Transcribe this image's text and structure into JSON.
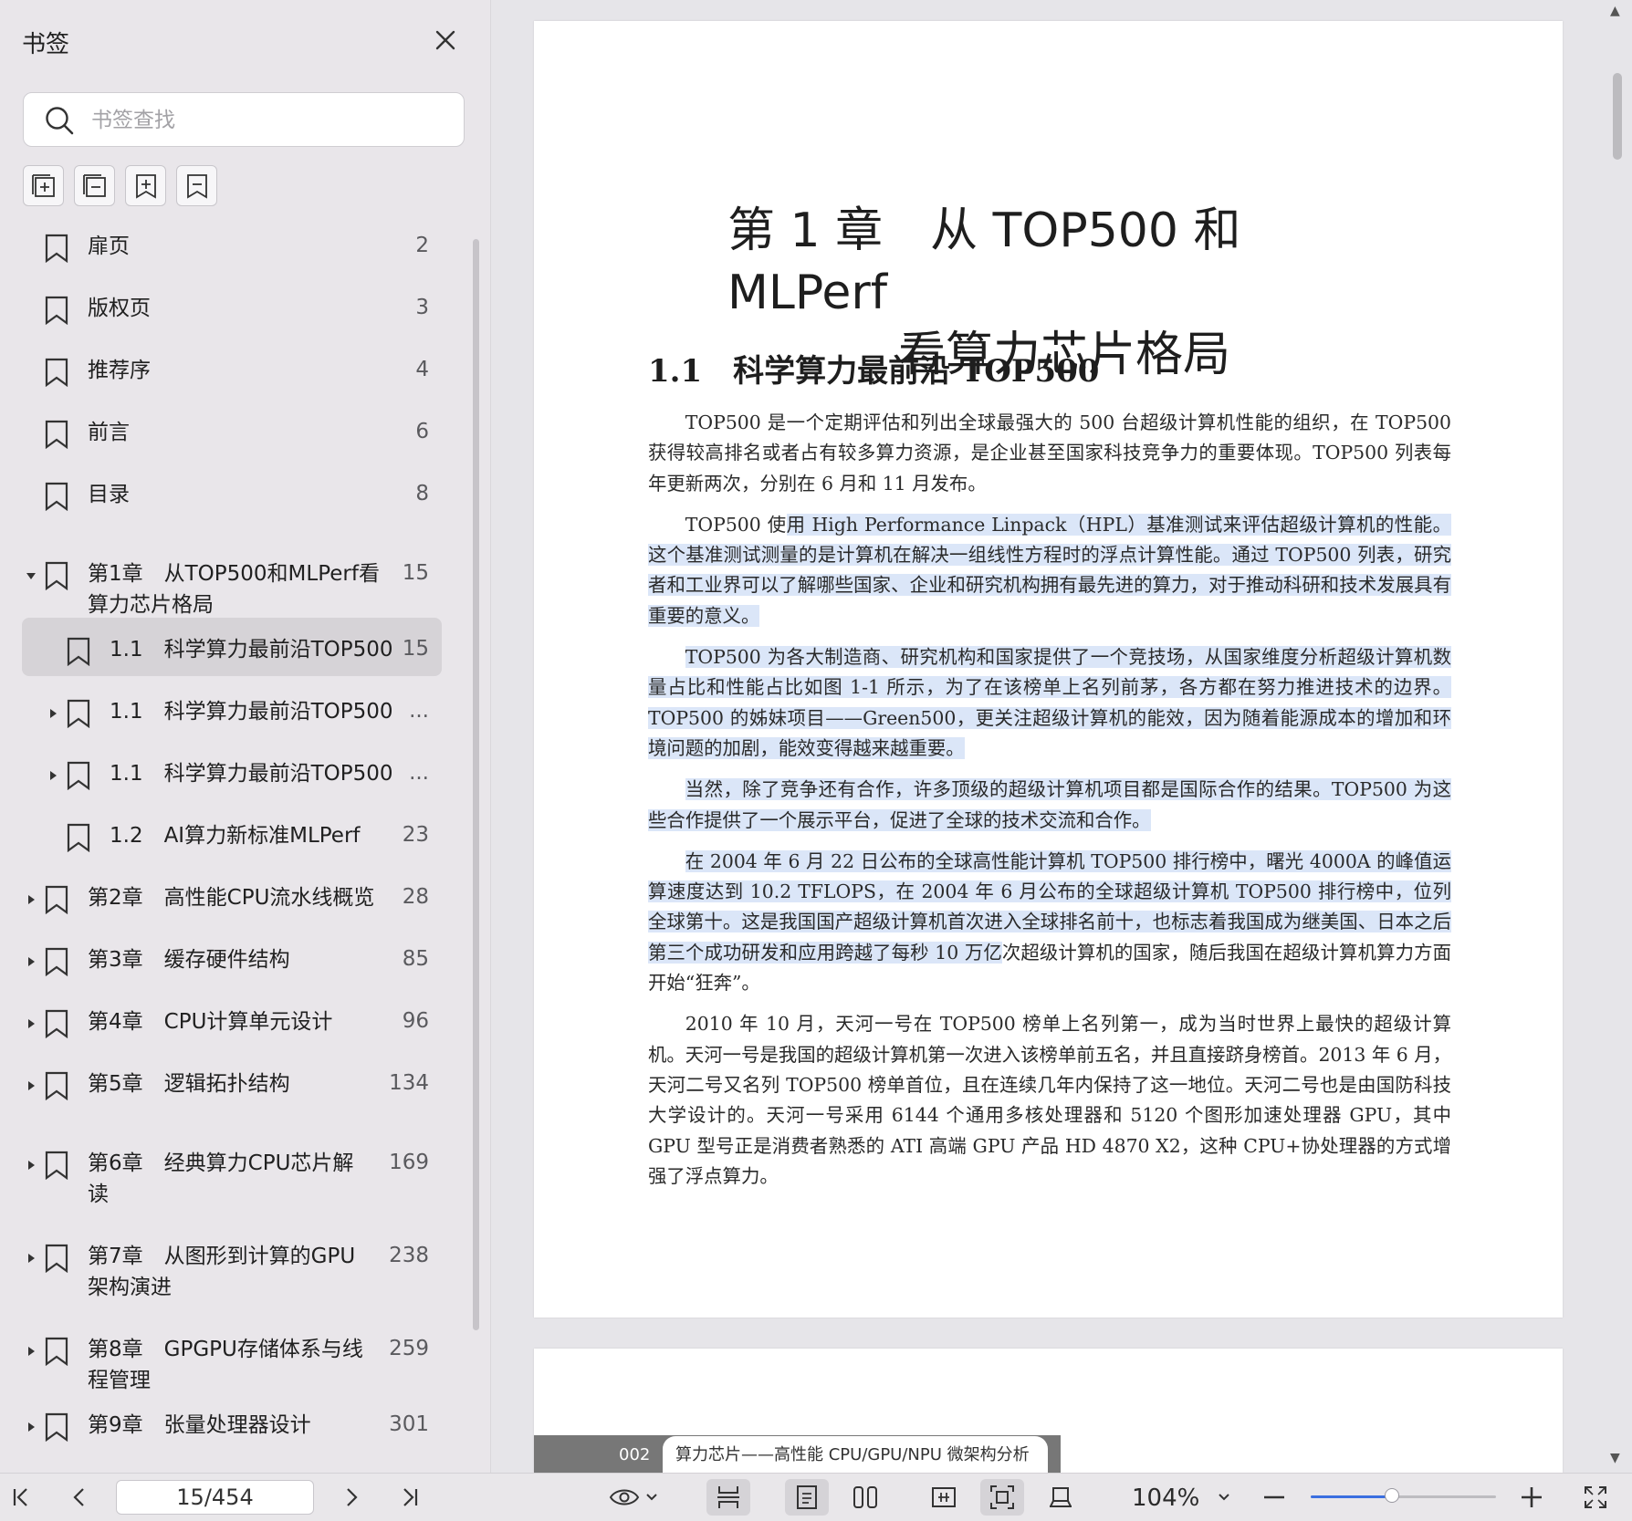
{
  "sidebar": {
    "title": "书签",
    "search_placeholder": "书签查找",
    "tool_icons": [
      "expand-all-icon",
      "collapse-all-icon",
      "add-bookmark-icon",
      "remove-bookmark-icon"
    ],
    "items": [
      {
        "label_lines": [
          "扉页"
        ],
        "page": "2",
        "level": 0,
        "expander": "none"
      },
      {
        "label_lines": [
          "版权页"
        ],
        "page": "3",
        "level": 0,
        "expander": "none"
      },
      {
        "label_lines": [
          "推荐序"
        ],
        "page": "4",
        "level": 0,
        "expander": "none"
      },
      {
        "label_lines": [
          "前言"
        ],
        "page": "6",
        "level": 0,
        "expander": "none"
      },
      {
        "label_lines": [
          "目录"
        ],
        "page": "8",
        "level": 0,
        "expander": "none"
      },
      {
        "label_lines": [
          "第1章　从TOP500和MLPerf看",
          "算力芯片格局"
        ],
        "page": "15",
        "level": 0,
        "expander": "expanded"
      },
      {
        "label_lines": [
          "1.1　科学算力最前沿TOP500"
        ],
        "page": "15",
        "level": 1,
        "expander": "none",
        "active": true
      },
      {
        "label_lines": [
          "1.1　科学算力最前沿TOP500"
        ],
        "page": "...",
        "level": 1,
        "expander": "collapsed"
      },
      {
        "label_lines": [
          "1.1　科学算力最前沿TOP500"
        ],
        "page": "...",
        "level": 1,
        "expander": "collapsed"
      },
      {
        "label_lines": [
          "1.2　AI算力新标准MLPerf"
        ],
        "page": "23",
        "level": 1,
        "expander": "none"
      },
      {
        "label_lines": [
          "第2章　高性能CPU流水线概览"
        ],
        "page": "28",
        "level": 0,
        "expander": "collapsed"
      },
      {
        "label_lines": [
          "第3章　缓存硬件结构"
        ],
        "page": "85",
        "level": 0,
        "expander": "collapsed"
      },
      {
        "label_lines": [
          "第4章　CPU计算单元设计"
        ],
        "page": "96",
        "level": 0,
        "expander": "collapsed"
      },
      {
        "label_lines": [
          "第5章　逻辑拓扑结构"
        ],
        "page": "134",
        "level": 0,
        "expander": "collapsed"
      },
      {
        "label_lines": [
          "第6章　经典算力CPU芯片解",
          "读"
        ],
        "page": "169",
        "level": 0,
        "expander": "collapsed"
      },
      {
        "label_lines": [
          "第7章　从图形到计算的GPU",
          "架构演进"
        ],
        "page": "238",
        "level": 0,
        "expander": "collapsed"
      },
      {
        "label_lines": [
          "第8章　GPGPU存储体系与线",
          "程管理"
        ],
        "page": "259",
        "level": 0,
        "expander": "collapsed"
      },
      {
        "label_lines": [
          "第9章　张量处理器设计"
        ],
        "page": "301",
        "level": 0,
        "expander": "collapsed"
      }
    ]
  },
  "document": {
    "chapter_title_line1": "第 1 章　从 TOP500 和 MLPerf",
    "chapter_title_line2": "看算力芯片格局",
    "section_title": "1.1　科学算力最前沿 TOP500",
    "paragraphs": [
      [
        {
          "t": "TOP500 是一个定期评估和列出全球最强大的 500 台超级计算机性能的组织，在 TOP500 获得较高排名或者占有较多算力资源，是企业甚至国家科技竞争力的重要体现。TOP500 列表每年更新两次，分别在 6 月和 11 月发布。",
          "sel": false
        }
      ],
      [
        {
          "t": "TOP500 使",
          "sel": false
        },
        {
          "t": "用 High Performance Linpack（HPL）基准测试来评估超级计算机的性能。这个基准测试测量的是计算机在解决一组线性方程时的浮点计算性能。通过 TOP500 列表，研究者和工业界可以了解哪些国家、企业和研究机构拥有最先进的算力，对于推动科研和技术发展具有重要的意义。",
          "sel": true
        }
      ],
      [
        {
          "t": "TOP500 为各大制造商、研究机构和国家提供了一个竞技场，从国家维度分析超级计算机数量占比和性能占比如图 1-1 所示，为了在该榜单上名列前茅，各方都在努力推进技术的边界。TOP500 的姊妹项目——Green500，更关注超级计算机的能效，因为随着能源成本的增加和环境问题的加剧，能效变得越来越重要。",
          "sel": true
        }
      ],
      [
        {
          "t": "当然，除了竞争还有合作，许多顶级的超级计算机项目都是国际合作的结果。TOP500 为这些合作提供了一个展示平台，促进了全球的技术交流和合作。",
          "sel": true
        }
      ],
      [
        {
          "t": "在 2004 年 6 月 22 日公布的全球高性能计算机 TOP500 排行榜中，曙光 4000A 的峰值运算速度达到 10.2 TFLOPS，在 2004 年 6 月公布的全球超级计算机 TOP500 排行榜中，位列全球第十。这是我国国产超级计算机首次进入全球排名前十，也标志着我国成为继美国、日本之后第三个成功研发和应用跨越了每秒 10 万亿",
          "sel": true
        },
        {
          "t": "次超级计算机的国家，随后我国在超级计算机算力方面开始“狂奔”。",
          "sel": false
        }
      ],
      [
        {
          "t": "2010 年 10 月，天河一号在 TOP500 榜单上名列第一，成为当时世界上最快的超级计算机。天河一号是我国的超级计算机第一次进入该榜单前五名，并且直接跻身榜首。2013 年 6 月，天河二号又名列 TOP500 榜单首位，且在连续几年内保持了这一地位。天河二号也是由国防科技大学设计的。天河一号采用 6144 个通用多核处理器和 5120 个图形加速处理器 GPU，其中 GPU 型号正是消费者熟悉的 ATI 高端 GPU 产品 HD 4870 X2，这种 CPU+协处理器的方式增强了浮点算力。",
          "sel": false
        }
      ]
    ],
    "next_page_number": "002",
    "next_page_header": "算力芯片——高性能 CPU/GPU/NPU 微架构分析"
  },
  "toolbar": {
    "page_indicator": "15/454",
    "zoom_label": "104%",
    "zoom_slider_value": 0.44
  },
  "colors": {
    "selection": "#dbe6f8",
    "slider_accent": "#3b6fe0",
    "sidebar_bg": "#e9e6ea",
    "active_row": "#d6d3d7"
  }
}
